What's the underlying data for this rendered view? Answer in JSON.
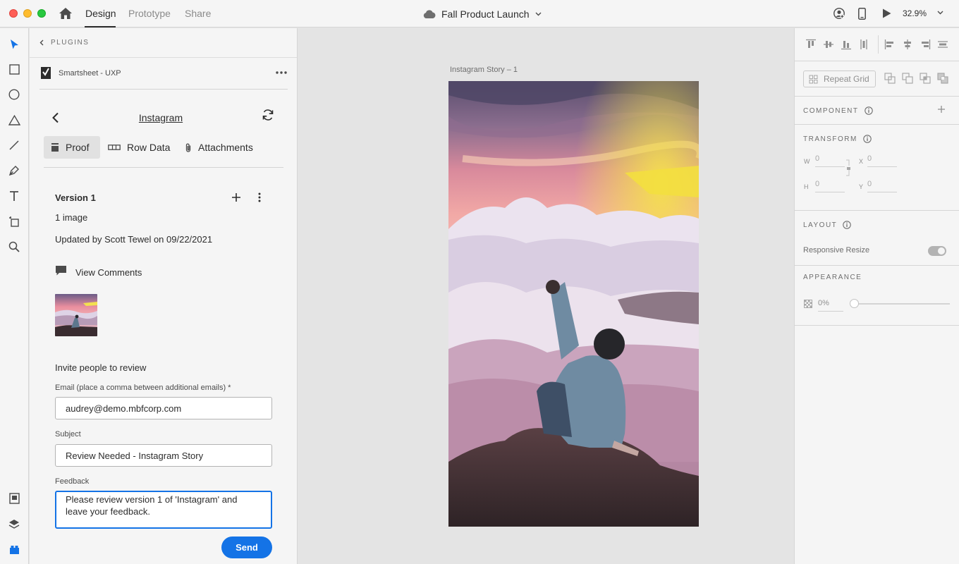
{
  "app": {
    "tabs": [
      {
        "label": "Design",
        "active": true
      },
      {
        "label": "Prototype",
        "active": false
      },
      {
        "label": "Share",
        "active": false
      }
    ],
    "document_title": "Fall Product Launch",
    "zoom": "32.9%"
  },
  "tools": [
    "select-tool-icon",
    "rectangle-tool-icon",
    "ellipse-tool-icon",
    "polygon-tool-icon",
    "line-tool-icon",
    "pen-tool-icon",
    "text-tool-icon",
    "artboard-tool-icon",
    "zoom-tool-icon",
    "document-assets-icon",
    "layers-icon",
    "plugins-icon"
  ],
  "plugin_panel": {
    "header": "PLUGINS",
    "plugin_name": "Smartsheet - UXP",
    "sheet_title": "Instagram",
    "tabs": [
      {
        "label": "Proof",
        "icon": "proof-icon",
        "active": true
      },
      {
        "label": "Row Data",
        "icon": "row-data-icon",
        "active": false
      },
      {
        "label": "Attachments",
        "icon": "paperclip-icon",
        "active": false
      }
    ],
    "version": {
      "title": "Version 1",
      "image_count": "1 image",
      "updated": "Updated by Scott Tewel on 09/22/2021",
      "view_comments": "View Comments"
    },
    "invite": {
      "heading": "Invite people to review",
      "email_label": "Email (place a comma between additional emails) *",
      "email_value": "audrey@demo.mbfcorp.com",
      "subject_label": "Subject",
      "subject_value": "Review Needed - Instagram Story",
      "feedback_label": "Feedback",
      "feedback_value": "Please review version 1 of 'Instagram' and leave your feedback.",
      "send_label": "Send"
    }
  },
  "canvas": {
    "artboard_name": "Instagram Story – 1"
  },
  "inspector": {
    "repeat_grid": "Repeat Grid",
    "component_heading": "COMPONENT",
    "transform_heading": "TRANSFORM",
    "w_label": "W",
    "w_value": "0",
    "x_label": "X",
    "x_value": "0",
    "h_label": "H",
    "h_value": "0",
    "y_label": "Y",
    "y_value": "0",
    "layout_heading": "LAYOUT",
    "responsive_resize": "Responsive Resize",
    "appearance_heading": "APPEARANCE",
    "opacity": "0%"
  },
  "colors": {
    "accent": "#1473e6",
    "panel_bg": "#f5f5f5",
    "canvas_bg": "#e4e4e4"
  }
}
